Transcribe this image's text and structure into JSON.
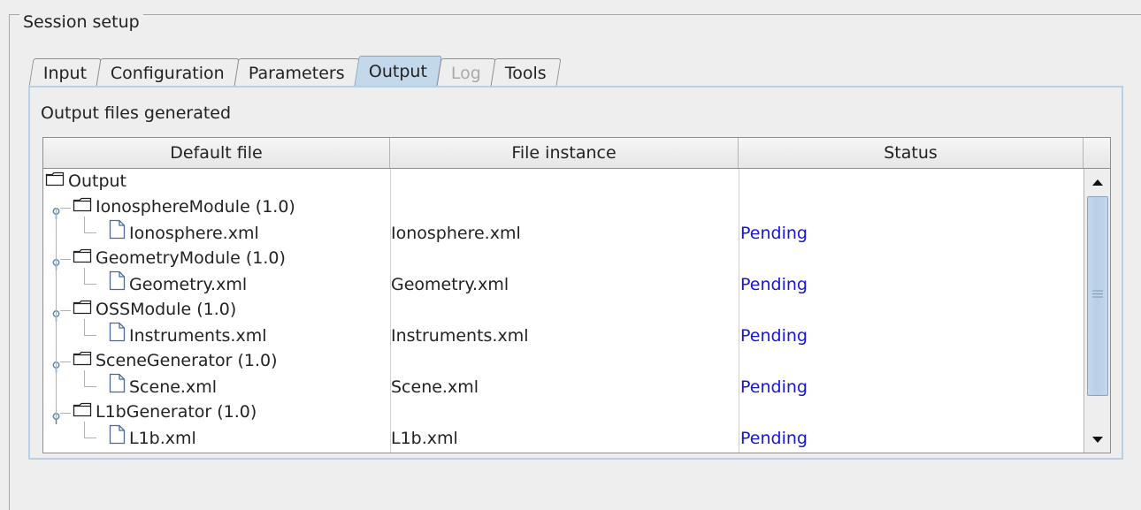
{
  "group_title": "Session setup",
  "tabs": [
    {
      "label": "Input",
      "state": "normal"
    },
    {
      "label": "Configuration",
      "state": "normal"
    },
    {
      "label": "Parameters",
      "state": "normal"
    },
    {
      "label": "Output",
      "state": "selected"
    },
    {
      "label": "Log",
      "state": "disabled"
    },
    {
      "label": "Tools",
      "state": "normal"
    }
  ],
  "panel_label": "Output files generated",
  "table": {
    "headers": [
      "Default file",
      "File instance",
      "Status"
    ],
    "root": "Output",
    "modules": [
      {
        "name": "IonosphereModule (1.0)",
        "file": "Ionosphere.xml",
        "instance": "Ionosphere.xml",
        "status": "Pending"
      },
      {
        "name": "GeometryModule (1.0)",
        "file": "Geometry.xml",
        "instance": "Geometry.xml",
        "status": "Pending"
      },
      {
        "name": "OSSModule (1.0)",
        "file": "Instruments.xml",
        "instance": "Instruments.xml",
        "status": "Pending"
      },
      {
        "name": "SceneGenerator (1.0)",
        "file": "Scene.xml",
        "instance": "Scene.xml",
        "status": "Pending"
      },
      {
        "name": "L1bGenerator (1.0)",
        "file": "L1b.xml",
        "instance": "L1b.xml",
        "status": "Pending"
      }
    ]
  },
  "colors": {
    "status_text": "#1515e0",
    "selected_tab": "#c4d8ec",
    "panel_border": "#b8cfe6"
  },
  "icons": {
    "root": "folder-icon",
    "module": "folder-icon",
    "file": "file-icon",
    "scroll_up": "arrow-up-icon",
    "scroll_down": "arrow-down-icon"
  }
}
